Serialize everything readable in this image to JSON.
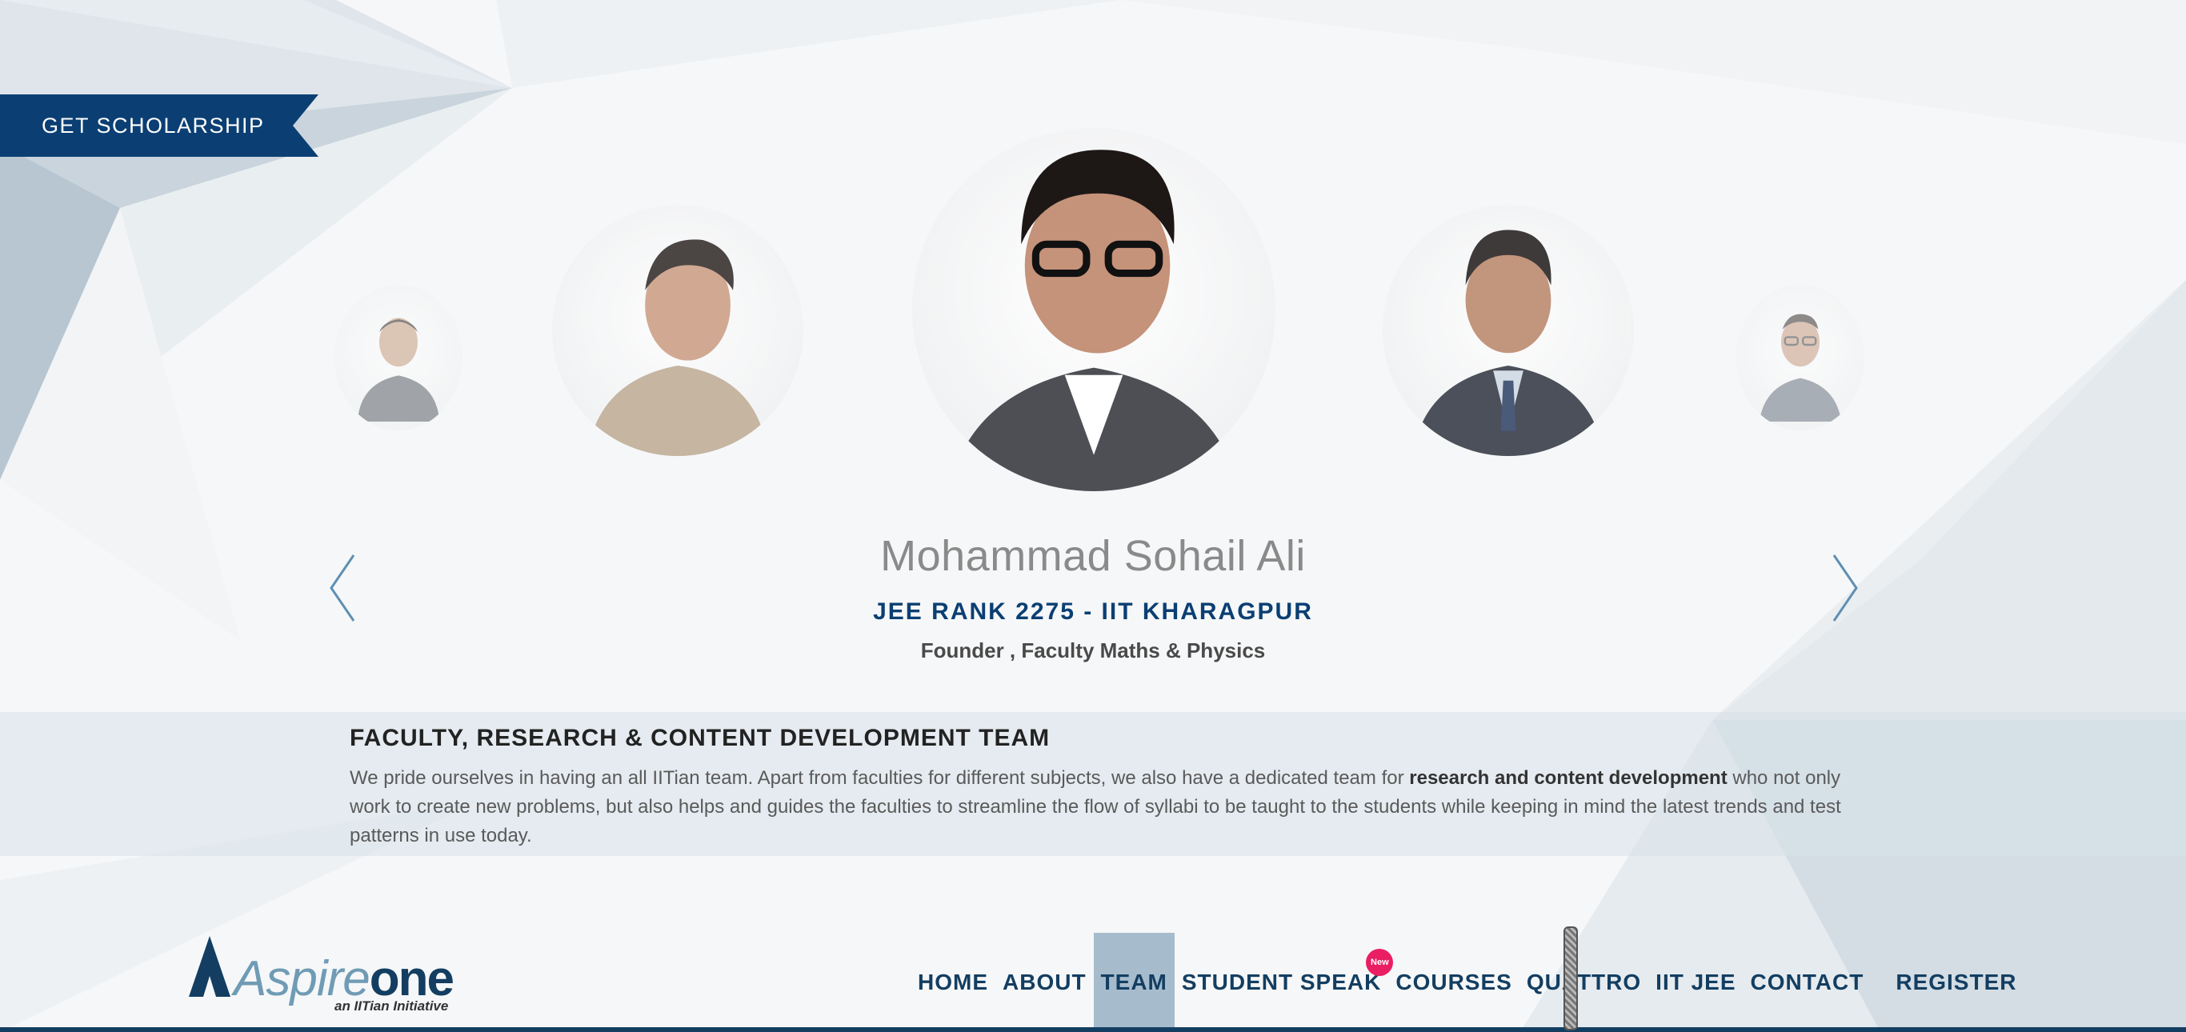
{
  "ribbon": {
    "label": "GET SCHOLARSHIP"
  },
  "carousel": {
    "prev_icon": "chevron-left-icon",
    "next_icon": "chevron-right-icon",
    "current": {
      "name": "Mohammad Sohail Ali",
      "rank": "JEE RANK 2275 - IIT KHARAGPUR",
      "role": "Founder , Faculty Maths & Physics"
    }
  },
  "section": {
    "title": "FACULTY, RESEARCH & CONTENT DEVELOPMENT TEAM",
    "text_before": "We pride ourselves in having an all IITian team. Apart from faculties for different subjects, we also have a dedicated team for ",
    "text_bold": "research and content development",
    "text_after": " who not only work to create new problems, but also helps and guides the faculties to streamline the flow of syllabi to be taught to the students while keeping in mind the latest trends and test patterns in use today."
  },
  "logo": {
    "word_light": "Aspire",
    "word_bold": "one",
    "tagline": "an IITian Initiative"
  },
  "nav": {
    "items": [
      {
        "label": "HOME"
      },
      {
        "label": "ABOUT"
      },
      {
        "label": "TEAM"
      },
      {
        "label": "STUDENT SPEAK"
      },
      {
        "label": "COURSES"
      },
      {
        "label": "QUATTRO"
      },
      {
        "label": "IIT JEE"
      },
      {
        "label": "CONTACT"
      },
      {
        "label": "REGISTER"
      }
    ],
    "new_badge": "New"
  },
  "colors": {
    "brand": "#133e61",
    "accent_blue": "#0b3f73",
    "badge": "#e91e63",
    "active_tab": "#a6bccd"
  }
}
